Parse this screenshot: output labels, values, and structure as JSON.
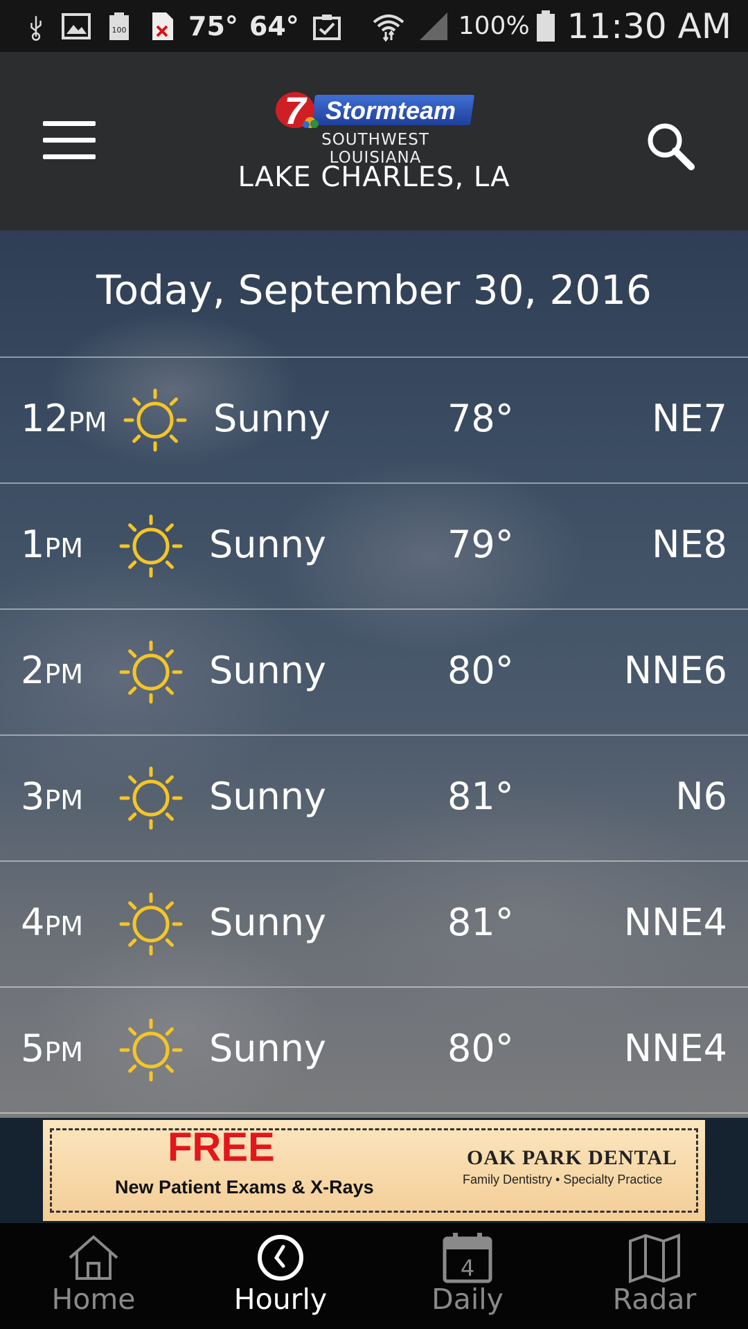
{
  "status_bar": {
    "temp1": "75°",
    "temp2": "64°",
    "battery_small": "100",
    "battery_pct": "100%",
    "time": "11:30 AM"
  },
  "header": {
    "logo_number": "7",
    "logo_name": "Stormteam",
    "logo_subtitle": "SOUTHWEST LOUISIANA",
    "location": "LAKE CHARLES, LA"
  },
  "hourly": {
    "date_title": "Today, September 30, 2016",
    "rows": [
      {
        "hour": "12",
        "ampm": "PM",
        "icon": "sun-icon",
        "condition": "Sunny",
        "temp": "78°",
        "wind": "NE7"
      },
      {
        "hour": "1",
        "ampm": "PM",
        "icon": "sun-icon",
        "condition": "Sunny",
        "temp": "79°",
        "wind": "NE8"
      },
      {
        "hour": "2",
        "ampm": "PM",
        "icon": "sun-icon",
        "condition": "Sunny",
        "temp": "80°",
        "wind": "NNE6"
      },
      {
        "hour": "3",
        "ampm": "PM",
        "icon": "sun-icon",
        "condition": "Sunny",
        "temp": "81°",
        "wind": "N6"
      },
      {
        "hour": "4",
        "ampm": "PM",
        "icon": "sun-icon",
        "condition": "Sunny",
        "temp": "81°",
        "wind": "NNE4"
      },
      {
        "hour": "5",
        "ampm": "PM",
        "icon": "sun-icon",
        "condition": "Sunny",
        "temp": "80°",
        "wind": "NNE4"
      }
    ]
  },
  "ad": {
    "headline": "FREE",
    "line": "New Patient Exams & X-Rays",
    "brand": "OAK PARK DENTAL",
    "tagline": "Family Dentistry • Specialty Practice"
  },
  "nav": {
    "items": [
      {
        "label": "Home",
        "icon": "home-icon"
      },
      {
        "label": "Hourly",
        "icon": "clock-icon"
      },
      {
        "label": "Daily",
        "icon": "calendar-icon",
        "badge": "4"
      },
      {
        "label": "Radar",
        "icon": "map-icon"
      }
    ],
    "active": "Hourly"
  },
  "colors": {
    "sun": "#f5c527",
    "header_bg": "#2c2d2f",
    "ad_red": "#e3161b"
  }
}
